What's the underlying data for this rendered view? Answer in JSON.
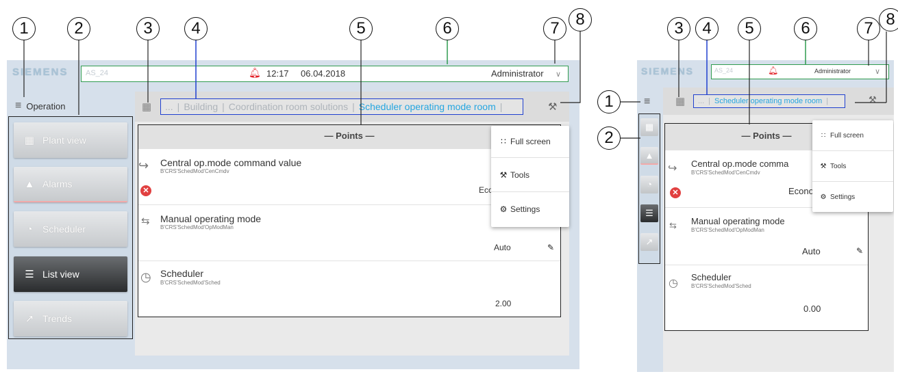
{
  "callouts": [
    "1",
    "2",
    "3",
    "4",
    "5",
    "6",
    "7",
    "8"
  ],
  "brand": "SIEMENS",
  "device": "AS_24",
  "time": "12:17",
  "date": "06.04.2018",
  "user": "Administrator",
  "operation_label": "Operation",
  "nav": [
    {
      "label": "Plant view",
      "icon": "plant-view-icon"
    },
    {
      "label": "Alarms",
      "icon": "bell-icon"
    },
    {
      "label": "Scheduler",
      "icon": "clock-icon"
    },
    {
      "label": "List view",
      "icon": "list-icon",
      "active": true
    },
    {
      "label": "Trends",
      "icon": "trend-chart-icon"
    }
  ],
  "breadcrumb": [
    "...",
    "Building",
    "Coordination room solutions",
    "Scheduler operating mode room"
  ],
  "breadcrumb_short": [
    "...",
    "Scheduler operating mode room"
  ],
  "panel_title": "— Points —",
  "points": [
    {
      "name": "Central op.mode command value",
      "path": "B'CRS'SchedMod'CenCmdv",
      "value": "Eco"
    },
    {
      "name": "Manual operating mode",
      "path": "B'CRS'SchedMod'OpModMan",
      "value": "Auto"
    },
    {
      "name": "Scheduler",
      "path": "B'CRS'SchedMod'Sched",
      "value": "2.00"
    }
  ],
  "points_right": {
    "name0": "Central op.mode comma",
    "value0": "Econor",
    "value2": "0.00"
  },
  "menu": [
    {
      "label": "Full screen",
      "icon": "full-screen-icon"
    },
    {
      "label": "Tools",
      "icon": "wrench-icon"
    },
    {
      "label": "Settings",
      "icon": "gear-icon"
    }
  ],
  "colors": {
    "callout_line_green": "#2f9b4f",
    "callout_line_blue": "#1f3fcf",
    "alarm_red": "#e21b22",
    "breadcrumb_current": "#26a6e0",
    "screen_bg": "#d6e0eb"
  }
}
